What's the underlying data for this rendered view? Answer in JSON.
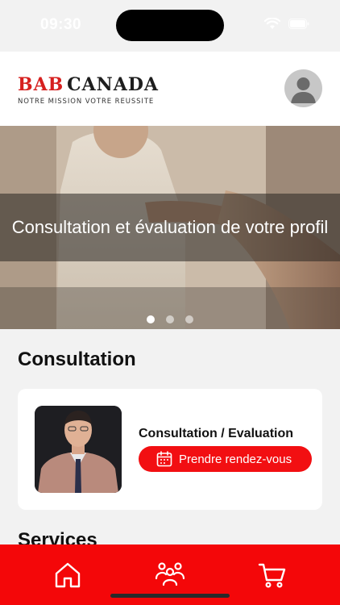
{
  "status_bar": {
    "time": "09:30"
  },
  "header": {
    "logo": {
      "brand_part1": "BAB",
      "brand_part2": "CANADA",
      "tagline": "NOTRE MISSION VOTRE REUSSITE"
    },
    "avatar_icon": "person-icon"
  },
  "banner": {
    "caption": "Consultation et évaluation de votre profil",
    "active_slide": 1,
    "slide_count": 3
  },
  "consultation": {
    "section_title": "Consultation",
    "card": {
      "title": "Consultation / Evaluation",
      "button_label": "Prendre rendez-vous",
      "button_icon": "calendar-icon"
    }
  },
  "services": {
    "section_title": "Services"
  },
  "bottom_nav": {
    "items": [
      {
        "icon": "home-icon"
      },
      {
        "icon": "users-icon"
      },
      {
        "icon": "cart-icon"
      }
    ]
  },
  "colors": {
    "accent": "#f20f12",
    "nav_background": "#f40709",
    "page_background": "#f2f2f2"
  }
}
